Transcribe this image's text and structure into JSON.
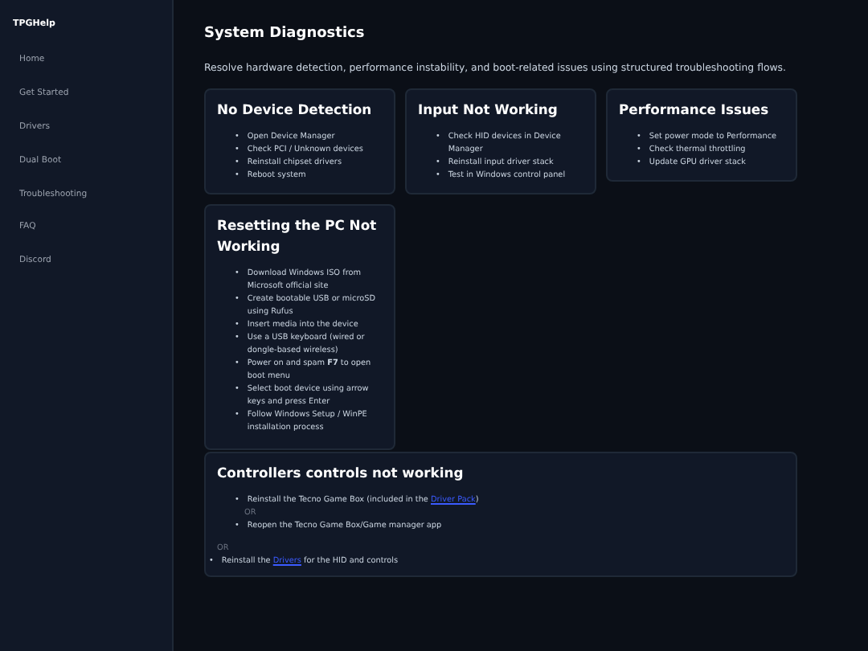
{
  "sidebar": {
    "brand": "TPGHelp",
    "items": [
      {
        "label": "Home",
        "selected": false
      },
      {
        "label": "Get Started",
        "selected": false
      },
      {
        "label": "Drivers",
        "selected": false
      },
      {
        "label": "Dual Boot",
        "selected": false
      },
      {
        "label": "Troubleshooting",
        "selected": false
      },
      {
        "label": "FAQ",
        "selected": false
      },
      {
        "label": "Discord",
        "selected": false
      }
    ]
  },
  "page": {
    "title": "System Diagnostics",
    "subtitle": "Resolve hardware detection, performance instability, and boot-related issues using structured troubleshooting flows."
  },
  "cards": [
    {
      "title": "No Device Detection",
      "steps": [
        {
          "marker": "•",
          "text": "Open Device Manager"
        },
        {
          "marker": "•",
          "text": "Check PCI / Unknown devices"
        },
        {
          "marker": "•",
          "text": "Reinstall chipset drivers"
        },
        {
          "marker": "•",
          "text": "Reboot system"
        }
      ]
    },
    {
      "title": "Input Not Working",
      "steps": [
        {
          "marker": "•",
          "text": "Check HID devices in Device Manager"
        },
        {
          "marker": "•",
          "text": "Reinstall input driver stack"
        },
        {
          "marker": "•",
          "text": "Test in Windows control panel"
        }
      ]
    },
    {
      "title": "Performance Issues",
      "steps": [
        {
          "marker": "•",
          "text": "Set power mode to Performance"
        },
        {
          "marker": "•",
          "text": "Check thermal throttling"
        },
        {
          "marker": "•",
          "text": "Update GPU driver stack"
        }
      ]
    },
    {
      "title": "Resetting the PC Not Working",
      "steps": [
        {
          "marker": "•",
          "text": "Download Windows ISO from Microsoft official site"
        },
        {
          "marker": "•",
          "text": "Create bootable USB or microSD using Rufus"
        },
        {
          "marker": "•",
          "text": "Insert media into the device"
        },
        {
          "marker": "•",
          "text": "Use a USB keyboard (wired or dongle-based wireless)"
        },
        {
          "marker": "•",
          "text": "Power on and spam **F7** to open boot menu"
        },
        {
          "marker": "•",
          "text": "Select boot device using arrow keys and press Enter"
        },
        {
          "marker": "•",
          "text": "Follow Windows Setup / WinPE installation process"
        }
      ]
    }
  ],
  "controllers": {
    "title": "Controllers controls not working",
    "items": [
      {
        "kind": "bullet",
        "marker": "•",
        "text": "Reinstall the Tecno Game Box (included in the ",
        "link": "Driver Pack",
        "after": ")"
      },
      {
        "kind": "or",
        "text": "OR"
      },
      {
        "kind": "bullet",
        "marker": "•",
        "text": "Reopen the Tecno Game Box/Game manager app"
      }
    ],
    "or": "OR",
    "final": {
      "marker": "•",
      "text": "Reinstall the ",
      "link": "Drivers",
      "after": " for the HID and controls"
    }
  }
}
